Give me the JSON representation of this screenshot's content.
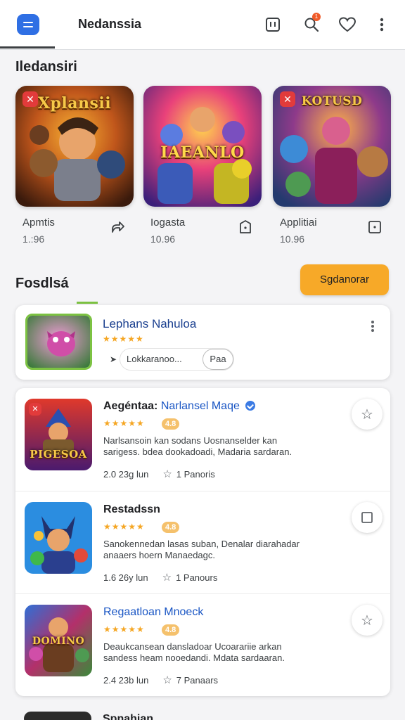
{
  "header": {
    "app_title": "Nedanssia",
    "notification_count": "1",
    "icons": [
      "menu-icon",
      "ad-icon",
      "search-icon",
      "heart-icon",
      "more-icon"
    ]
  },
  "featured": {
    "section_title": "Iledansiri",
    "items": [
      {
        "art_caption": "Xplansii",
        "name": "Apmtis",
        "sub": "1.:96",
        "action_icon": "share-icon"
      },
      {
        "art_caption": "IAEANLO",
        "name": "Iogasta",
        "sub": "10.96",
        "action_icon": "bookmark-icon"
      },
      {
        "art_caption": "KOTUSD",
        "name": "Applitiai",
        "sub": "10.96",
        "action_icon": "square-icon"
      }
    ]
  },
  "list_section": {
    "title": "Fosdlsá",
    "cta_label": "Sgdanorar",
    "highlight_card": {
      "title": "Lephans Nahuloa",
      "rating": "★★★★★",
      "input_value": "Lokkaranoo...",
      "input_button": "Paa"
    },
    "items": [
      {
        "title_main": "Aegéntaa:",
        "title_accent": "Narlansel Maqe",
        "verified": true,
        "rating": "★★★★★",
        "score": "4.8",
        "desc_line1": "Narlsansoin kan sodans Uosnanselder kan",
        "desc_line2": "sarigess. bdea dookadoadi, Madaria sardaran.",
        "stat1": "2.0 23g lun",
        "stat2": "1 Panoris",
        "thumb_caption": "PIGESOA",
        "action_icon": "star-icon"
      },
      {
        "title_main": "Restadssn",
        "title_accent": "",
        "verified": false,
        "rating": "★★★★★",
        "score": "4.8",
        "desc_line1": "Sanokennedan lasas suban, Denalar diarahadar",
        "desc_line2": "anaaers hoern Manaedagc.",
        "stat1": "1.6 26y lun",
        "stat2": "1 Panours",
        "thumb_caption": "",
        "action_icon": "square-icon"
      },
      {
        "title_main": "",
        "title_accent": "Regaatloan Mnoeck",
        "verified": false,
        "rating": "★★★★★",
        "score": "4.8",
        "desc_line1": "Deaukcansean dansladoar Ucoarariie arkan",
        "desc_line2": "sandess heam nooedandi. Mdata sardaaran.",
        "stat1": "2.4 23b lun",
        "stat2": "7 Panaars",
        "thumb_caption": "DOMINO",
        "action_icon": "star-icon"
      }
    ]
  },
  "bottom_peek": {
    "title": "Spnahian"
  },
  "colors": {
    "primary_blue": "#2f6fe4",
    "accent_orange": "#f7a928",
    "accent_green": "#7cc242",
    "link_blue": "#1a56c4",
    "star_gold": "#f5a623"
  }
}
